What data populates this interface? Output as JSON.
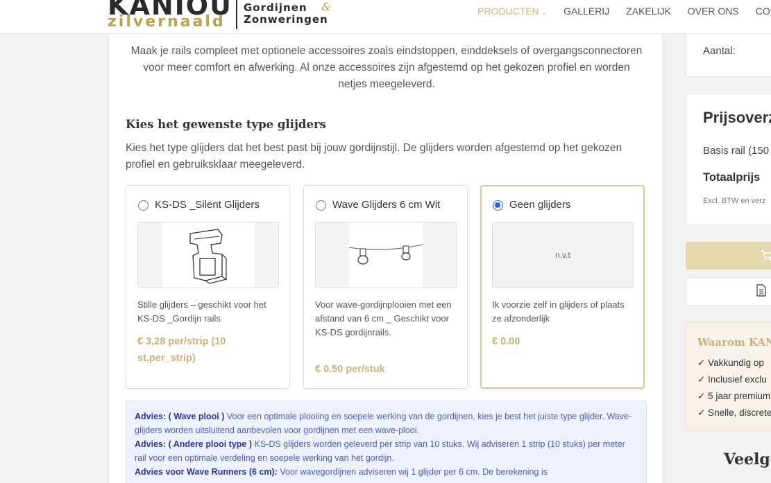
{
  "header": {
    "logo_top": "KANIOU",
    "logo_bottom": "zilvernaald",
    "logo_right1": "Gordijnen",
    "logo_amp": "&",
    "logo_right2": "Zonweringen",
    "nav": [
      {
        "label": "PRODUCTEN",
        "active": true
      },
      {
        "label": "GALLERIJ"
      },
      {
        "label": "ZAKELIJK"
      },
      {
        "label": "OVER ONS"
      },
      {
        "label": "CON"
      }
    ]
  },
  "main": {
    "intro": "Maak je rails compleet met optionele accessoires zoals eindstoppen, einddeksels of overgangsconnectoren voor meer comfort en afwerking. Al onze accessoires zijn afgestemd op het gekozen profiel en worden netjes meegeleverd.",
    "section_title": "Kies het gewenste type glijders",
    "section_desc": "Kies het type glijders dat het best past bij jouw gordijnstijl. De glijders worden afgestemd op het gekozen profiel en gebruiksklaar meegeleverd.",
    "options": [
      {
        "name": "KS-DS _Silent Glijders",
        "desc": "Stille glijders – geschikt voor het KS-DS _Gordijn rails",
        "price": "€ 3,28 per/strip (10 st.per_strip)",
        "selected": false
      },
      {
        "name": "Wave Glijders 6 cm Wit",
        "desc": "Voor wave-gordijnplooien met een afstand van 6 cm _ Geschikt voor KS-DS gordijnrails.",
        "price": "€ 0.50 per/stuk",
        "selected": false
      },
      {
        "name": "Geen glijders",
        "image_text": "n.v.t",
        "desc": "Ik voorzie zelf in glijders of plaats ze afzonderlijk",
        "price": "€ 0.00",
        "selected": true
      }
    ],
    "advice": {
      "label1": "Advies: ( Wave plooi )",
      "text1": " Voor een optimale plooiing en soepele werking van de gordijnen, kies je best het juiste type glijder. Wave-glijders worden uitsluitend aanbevolen voor gordijnen met een wave-plooi.",
      "label2": "Advies: ( Andere plooi type )",
      "text2": " KS-DS glijders worden geleverd per strip van 10 stuks. Wij adviseren 1 strip (10 stuks) per meter rail voor een optimale verdeling en soepele werking van het gordijn.",
      "label3": "Advies voor Wave Runners (6 cm):",
      "text3": " Voor wavegordijnen adviseren wij 1 glijder per 6 cm. De berekening is"
    }
  },
  "sidebar": {
    "aantal_label": "Aantal:",
    "prijs_title": "Prijsoverz",
    "basis": "Basis rail (150",
    "totaal": "Totaalprijs",
    "excl": "Excl. BTW en verz",
    "why_title": "Waarom KANIO",
    "why_items": [
      "✓ Vakkundig op",
      "✓ Inclusief exclu",
      "✓ 5 jaar premium",
      "✓ Snelle, discrete"
    ],
    "veelg": "Veelge"
  }
}
